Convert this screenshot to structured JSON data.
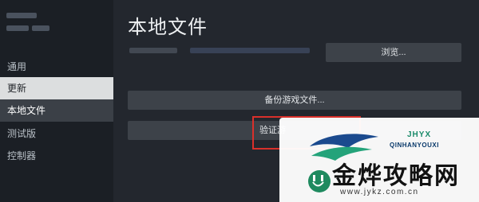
{
  "sidebar": {
    "items": [
      {
        "label": "通用"
      },
      {
        "label": "更新"
      },
      {
        "label": "本地文件"
      },
      {
        "label": "测试版"
      },
      {
        "label": "控制器"
      }
    ]
  },
  "main": {
    "title": "本地文件",
    "browse_label": "浏览...",
    "backup_label": "备份游戏文件...",
    "verify_label": "验证游"
  },
  "watermark": {
    "brand_small": "JHYX",
    "brand_latin": "QINHANYOUXI",
    "name": "金烨攻略网",
    "url": "www.jykz.com.cn"
  },
  "colors": {
    "highlight": "#d9302b",
    "accent_green": "#1a8a6a",
    "accent_blue": "#0a3a6b"
  }
}
